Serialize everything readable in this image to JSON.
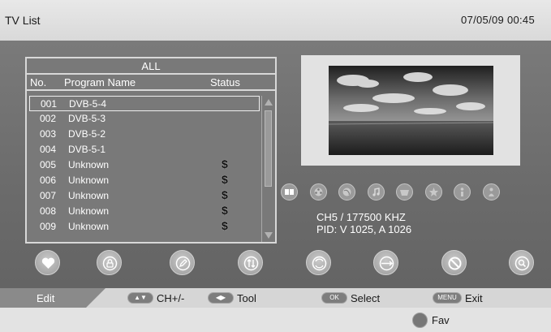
{
  "header": {
    "title": "TV List",
    "datetime": "07/05/09  00:45"
  },
  "list": {
    "group": "ALL",
    "columns": {
      "no": "No.",
      "name": "Program Name",
      "status": "Status"
    },
    "rows": [
      {
        "no": "001",
        "name": "DVB-5-4",
        "status": ""
      },
      {
        "no": "002",
        "name": "DVB-5-3",
        "status": ""
      },
      {
        "no": "003",
        "name": "DVB-5-2",
        "status": ""
      },
      {
        "no": "004",
        "name": "DVB-5-1",
        "status": ""
      },
      {
        "no": "005",
        "name": "Unknown",
        "status": "$"
      },
      {
        "no": "006",
        "name": "Unknown",
        "status": "$"
      },
      {
        "no": "007",
        "name": "Unknown",
        "status": "$"
      },
      {
        "no": "008",
        "name": "Unknown",
        "status": "$"
      },
      {
        "no": "009",
        "name": "Unknown",
        "status": "$"
      }
    ]
  },
  "info": {
    "freq": "CH5 / 177500  KHZ",
    "pid": "PID: V 1025, A 1026"
  },
  "help": {
    "edit": "Edit",
    "ch": "CH+/-",
    "tool": "Tool",
    "ok_key": "OK",
    "select": "Select",
    "menu_key": "MENU",
    "exit": "Exit"
  },
  "footer": {
    "fav": "Fav"
  },
  "icons": {
    "features": [
      "book-icon",
      "film-reel-icon",
      "globe-icon",
      "music-note-icon",
      "basket-icon",
      "star-icon",
      "info-person-icon",
      "person-icon"
    ],
    "actions": [
      "heart-icon",
      "lock-icon",
      "pencil-icon",
      "sort-arrows-icon",
      "move-icon",
      "skip-icon",
      "delete-icon",
      "search-icon"
    ]
  },
  "colors": {
    "panel": "#6e6e6e",
    "bar": "#d6d6d6",
    "highlight": "#eeeeee"
  }
}
